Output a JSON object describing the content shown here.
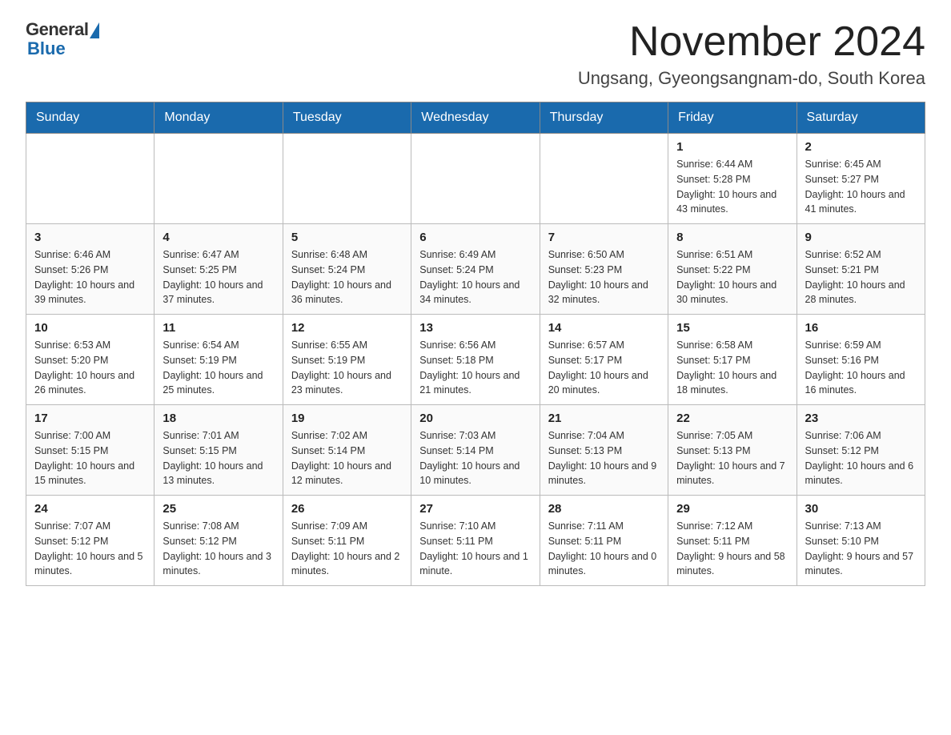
{
  "logo": {
    "general": "General",
    "blue": "Blue"
  },
  "title": "November 2024",
  "location": "Ungsang, Gyeongsangnam-do, South Korea",
  "headers": [
    "Sunday",
    "Monday",
    "Tuesday",
    "Wednesday",
    "Thursday",
    "Friday",
    "Saturday"
  ],
  "weeks": [
    [
      {
        "day": "",
        "info": ""
      },
      {
        "day": "",
        "info": ""
      },
      {
        "day": "",
        "info": ""
      },
      {
        "day": "",
        "info": ""
      },
      {
        "day": "",
        "info": ""
      },
      {
        "day": "1",
        "info": "Sunrise: 6:44 AM\nSunset: 5:28 PM\nDaylight: 10 hours and 43 minutes."
      },
      {
        "day": "2",
        "info": "Sunrise: 6:45 AM\nSunset: 5:27 PM\nDaylight: 10 hours and 41 minutes."
      }
    ],
    [
      {
        "day": "3",
        "info": "Sunrise: 6:46 AM\nSunset: 5:26 PM\nDaylight: 10 hours and 39 minutes."
      },
      {
        "day": "4",
        "info": "Sunrise: 6:47 AM\nSunset: 5:25 PM\nDaylight: 10 hours and 37 minutes."
      },
      {
        "day": "5",
        "info": "Sunrise: 6:48 AM\nSunset: 5:24 PM\nDaylight: 10 hours and 36 minutes."
      },
      {
        "day": "6",
        "info": "Sunrise: 6:49 AM\nSunset: 5:24 PM\nDaylight: 10 hours and 34 minutes."
      },
      {
        "day": "7",
        "info": "Sunrise: 6:50 AM\nSunset: 5:23 PM\nDaylight: 10 hours and 32 minutes."
      },
      {
        "day": "8",
        "info": "Sunrise: 6:51 AM\nSunset: 5:22 PM\nDaylight: 10 hours and 30 minutes."
      },
      {
        "day": "9",
        "info": "Sunrise: 6:52 AM\nSunset: 5:21 PM\nDaylight: 10 hours and 28 minutes."
      }
    ],
    [
      {
        "day": "10",
        "info": "Sunrise: 6:53 AM\nSunset: 5:20 PM\nDaylight: 10 hours and 26 minutes."
      },
      {
        "day": "11",
        "info": "Sunrise: 6:54 AM\nSunset: 5:19 PM\nDaylight: 10 hours and 25 minutes."
      },
      {
        "day": "12",
        "info": "Sunrise: 6:55 AM\nSunset: 5:19 PM\nDaylight: 10 hours and 23 minutes."
      },
      {
        "day": "13",
        "info": "Sunrise: 6:56 AM\nSunset: 5:18 PM\nDaylight: 10 hours and 21 minutes."
      },
      {
        "day": "14",
        "info": "Sunrise: 6:57 AM\nSunset: 5:17 PM\nDaylight: 10 hours and 20 minutes."
      },
      {
        "day": "15",
        "info": "Sunrise: 6:58 AM\nSunset: 5:17 PM\nDaylight: 10 hours and 18 minutes."
      },
      {
        "day": "16",
        "info": "Sunrise: 6:59 AM\nSunset: 5:16 PM\nDaylight: 10 hours and 16 minutes."
      }
    ],
    [
      {
        "day": "17",
        "info": "Sunrise: 7:00 AM\nSunset: 5:15 PM\nDaylight: 10 hours and 15 minutes."
      },
      {
        "day": "18",
        "info": "Sunrise: 7:01 AM\nSunset: 5:15 PM\nDaylight: 10 hours and 13 minutes."
      },
      {
        "day": "19",
        "info": "Sunrise: 7:02 AM\nSunset: 5:14 PM\nDaylight: 10 hours and 12 minutes."
      },
      {
        "day": "20",
        "info": "Sunrise: 7:03 AM\nSunset: 5:14 PM\nDaylight: 10 hours and 10 minutes."
      },
      {
        "day": "21",
        "info": "Sunrise: 7:04 AM\nSunset: 5:13 PM\nDaylight: 10 hours and 9 minutes."
      },
      {
        "day": "22",
        "info": "Sunrise: 7:05 AM\nSunset: 5:13 PM\nDaylight: 10 hours and 7 minutes."
      },
      {
        "day": "23",
        "info": "Sunrise: 7:06 AM\nSunset: 5:12 PM\nDaylight: 10 hours and 6 minutes."
      }
    ],
    [
      {
        "day": "24",
        "info": "Sunrise: 7:07 AM\nSunset: 5:12 PM\nDaylight: 10 hours and 5 minutes."
      },
      {
        "day": "25",
        "info": "Sunrise: 7:08 AM\nSunset: 5:12 PM\nDaylight: 10 hours and 3 minutes."
      },
      {
        "day": "26",
        "info": "Sunrise: 7:09 AM\nSunset: 5:11 PM\nDaylight: 10 hours and 2 minutes."
      },
      {
        "day": "27",
        "info": "Sunrise: 7:10 AM\nSunset: 5:11 PM\nDaylight: 10 hours and 1 minute."
      },
      {
        "day": "28",
        "info": "Sunrise: 7:11 AM\nSunset: 5:11 PM\nDaylight: 10 hours and 0 minutes."
      },
      {
        "day": "29",
        "info": "Sunrise: 7:12 AM\nSunset: 5:11 PM\nDaylight: 9 hours and 58 minutes."
      },
      {
        "day": "30",
        "info": "Sunrise: 7:13 AM\nSunset: 5:10 PM\nDaylight: 9 hours and 57 minutes."
      }
    ]
  ]
}
